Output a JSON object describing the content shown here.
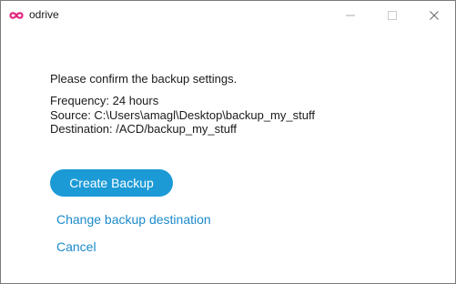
{
  "window": {
    "title": "odrive",
    "icon": "infinity-icon",
    "controls": [
      "minimize-icon",
      "maximize-icon",
      "close-icon"
    ]
  },
  "content": {
    "prompt": "Please confirm the backup settings.",
    "frequency": "Frequency: 24 hours",
    "source": "Source: C:\\Users\\amagl\\Desktop\\backup_my_stuff",
    "destination": "Destination: /ACD/backup_my_stuff"
  },
  "actions": {
    "create_label": "Create Backup",
    "change_destination_label": "Change backup destination",
    "cancel_label": "Cancel"
  },
  "colors": {
    "accent": "#1b9ad6",
    "link": "#1b8acb",
    "brand_icon": "#e0287f"
  }
}
